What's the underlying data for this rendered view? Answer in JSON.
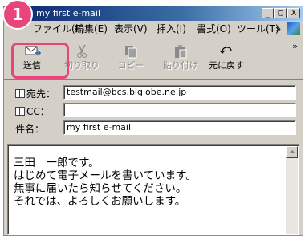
{
  "window": {
    "title": "my first e-mail",
    "buttons": [
      "_",
      "□",
      "X"
    ]
  },
  "badge": {
    "number": "1"
  },
  "menu": {
    "items": [
      "ファイル(F)",
      "編集(E)",
      "表示(V)",
      "挿入(I)",
      "書式(O)",
      "ツール(T)",
      "»"
    ]
  },
  "toolbar": {
    "buttons": [
      {
        "label": "送信",
        "icon": "send-icon",
        "enabled": true
      },
      {
        "label": "切り取り",
        "icon": "cut-icon",
        "enabled": false
      },
      {
        "label": "コピー",
        "icon": "copy-icon",
        "enabled": false
      },
      {
        "label": "貼り付け",
        "icon": "paste-icon",
        "enabled": false
      },
      {
        "label": "元に戻す",
        "icon": "undo-icon",
        "enabled": true
      }
    ],
    "overflow": "»"
  },
  "headers": {
    "to": {
      "label": "宛先：",
      "value": "testmail@bcs.biglobe.ne.jp"
    },
    "cc": {
      "label": "CC：",
      "value": ""
    },
    "subject": {
      "label": "件名：",
      "value": "my first e-mail"
    }
  },
  "body": {
    "lines": [
      "三田　一郎です。",
      "はじめて電子メールを書いています。",
      "無事に届いたら知らせてください。",
      "それでは、よろしくお願いします。"
    ]
  },
  "colors": {
    "highlight": "#e8457a",
    "titlebar": "#0a246a",
    "chrome": "#d4d0c8"
  }
}
